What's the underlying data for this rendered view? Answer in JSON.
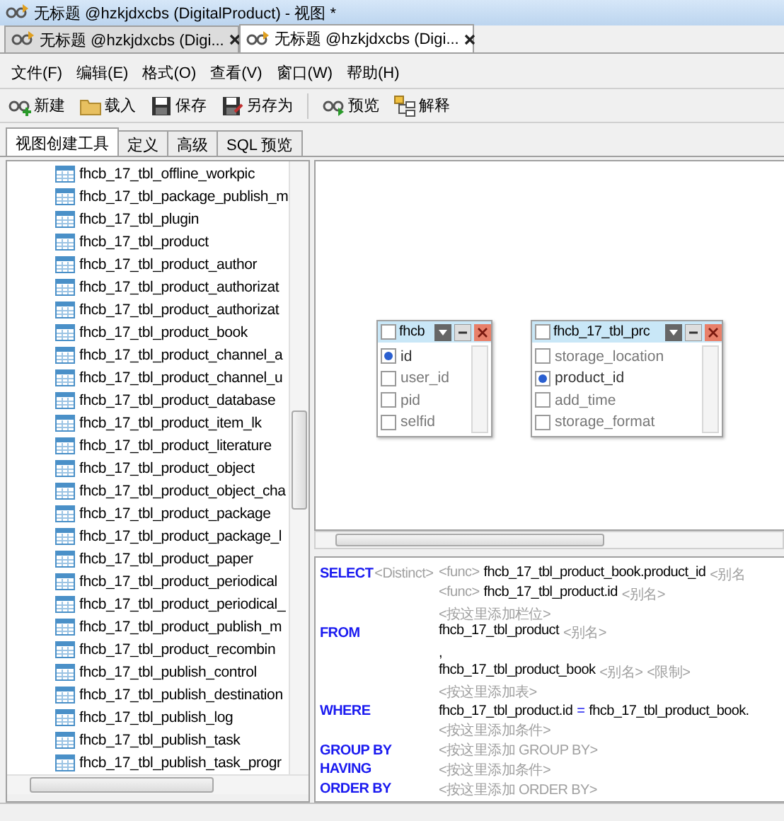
{
  "window": {
    "title": "无标题 @hzkjdxcbs (DigitalProduct) - 视图 *"
  },
  "document_tabs": [
    {
      "label": "无标题 @hzkjdxcbs (Digi...",
      "selected": false
    },
    {
      "label": "无标题 @hzkjdxcbs (Digi...",
      "selected": true
    }
  ],
  "menu": [
    "文件(F)",
    "编辑(E)",
    "格式(O)",
    "查看(V)",
    "窗口(W)",
    "帮助(H)"
  ],
  "toolbar": [
    {
      "kind": "new",
      "label": "新建"
    },
    {
      "kind": "open",
      "label": "载入"
    },
    {
      "kind": "save",
      "label": "保存"
    },
    {
      "kind": "save_as",
      "label": "另存为"
    },
    {
      "kind": "separator"
    },
    {
      "kind": "preview",
      "label": "预览"
    },
    {
      "kind": "explain",
      "label": "解释"
    }
  ],
  "view_tabs": [
    {
      "label": "视图创建工具",
      "selected": true
    },
    {
      "label": "定义",
      "selected": false
    },
    {
      "label": "高级",
      "selected": false
    },
    {
      "label": "SQL 预览",
      "selected": false
    }
  ],
  "table_list": {
    "items": [
      "fhcb_17_tbl_offline_workpic",
      "fhcb_17_tbl_package_publish_m",
      "fhcb_17_tbl_plugin",
      "fhcb_17_tbl_product",
      "fhcb_17_tbl_product_author",
      "fhcb_17_tbl_product_authorizat",
      "fhcb_17_tbl_product_authorizat",
      "fhcb_17_tbl_product_book",
      "fhcb_17_tbl_product_channel_a",
      "fhcb_17_tbl_product_channel_u",
      "fhcb_17_tbl_product_database",
      "fhcb_17_tbl_product_item_lk",
      "fhcb_17_tbl_product_literature",
      "fhcb_17_tbl_product_object",
      "fhcb_17_tbl_product_object_cha",
      "fhcb_17_tbl_product_package",
      "fhcb_17_tbl_product_package_l",
      "fhcb_17_tbl_product_paper",
      "fhcb_17_tbl_product_periodical",
      "fhcb_17_tbl_product_periodical_",
      "fhcb_17_tbl_product_publish_m",
      "fhcb_17_tbl_product_recombin",
      "fhcb_17_tbl_publish_control",
      "fhcb_17_tbl_publish_destination",
      "fhcb_17_tbl_publish_log",
      "fhcb_17_tbl_publish_task",
      "fhcb_17_tbl_publish_task_progr"
    ]
  },
  "diagram": {
    "tables": [
      {
        "title": "fhcb",
        "checked": false,
        "columns": [
          {
            "name": "id",
            "primary_key": true
          },
          {
            "name": "user_id",
            "primary_key": false
          },
          {
            "name": "pid",
            "primary_key": false
          },
          {
            "name": "selfid",
            "primary_key": false
          }
        ]
      },
      {
        "title": "fhcb_17_tbl_prc",
        "checked": false,
        "columns": [
          {
            "name": "storage_location",
            "primary_key": false
          },
          {
            "name": "product_id",
            "primary_key": true
          },
          {
            "name": "add_time",
            "primary_key": false
          },
          {
            "name": "storage_format",
            "primary_key": false
          }
        ]
      }
    ]
  },
  "sql": {
    "lines": [
      {
        "keyword": "SELECT",
        "lead": "<Distinct>",
        "parts": [
          {
            "kind": "placeholder",
            "text": "<func>"
          },
          {
            "kind": "text",
            "text": "fhcb_17_tbl_product_book.product_id"
          },
          {
            "kind": "placeholder",
            "text": "<别名"
          }
        ]
      },
      {
        "parts": [
          {
            "kind": "placeholder",
            "text": "<func>"
          },
          {
            "kind": "text",
            "text": "fhcb_17_tbl_product.id"
          },
          {
            "kind": "placeholder",
            "text": "<别名>"
          }
        ]
      },
      {
        "parts": [
          {
            "kind": "placeholder",
            "text": "<按这里添加栏位>"
          }
        ]
      },
      {
        "keyword": "FROM",
        "parts": [
          {
            "kind": "text",
            "text": "fhcb_17_tbl_product"
          },
          {
            "kind": "placeholder",
            "text": "<别名>"
          }
        ]
      },
      {
        "parts": [
          {
            "kind": "text",
            "text": ","
          }
        ]
      },
      {
        "parts": [
          {
            "kind": "text",
            "text": "fhcb_17_tbl_product_book"
          },
          {
            "kind": "placeholder",
            "text": "<别名>"
          },
          {
            "kind": "placeholder",
            "text": "<限制>"
          }
        ]
      },
      {
        "parts": [
          {
            "kind": "placeholder",
            "text": "<按这里添加表>"
          }
        ]
      },
      {
        "keyword": "WHERE",
        "parts": [
          {
            "kind": "text",
            "text": "fhcb_17_tbl_product.id"
          },
          {
            "kind": "operator",
            "text": "="
          },
          {
            "kind": "text",
            "text": "fhcb_17_tbl_product_book."
          }
        ]
      },
      {
        "parts": [
          {
            "kind": "placeholder",
            "text": "<按这里添加条件>"
          }
        ]
      },
      {
        "keyword": "GROUP BY",
        "parts": [
          {
            "kind": "placeholder",
            "text": "<按这里添加 GROUP BY>"
          }
        ]
      },
      {
        "keyword": "HAVING",
        "parts": [
          {
            "kind": "placeholder",
            "text": "<按这里添加条件>"
          }
        ]
      },
      {
        "keyword": "ORDER BY",
        "parts": [
          {
            "kind": "placeholder",
            "text": "<按这里添加 ORDER BY>"
          }
        ]
      }
    ]
  }
}
